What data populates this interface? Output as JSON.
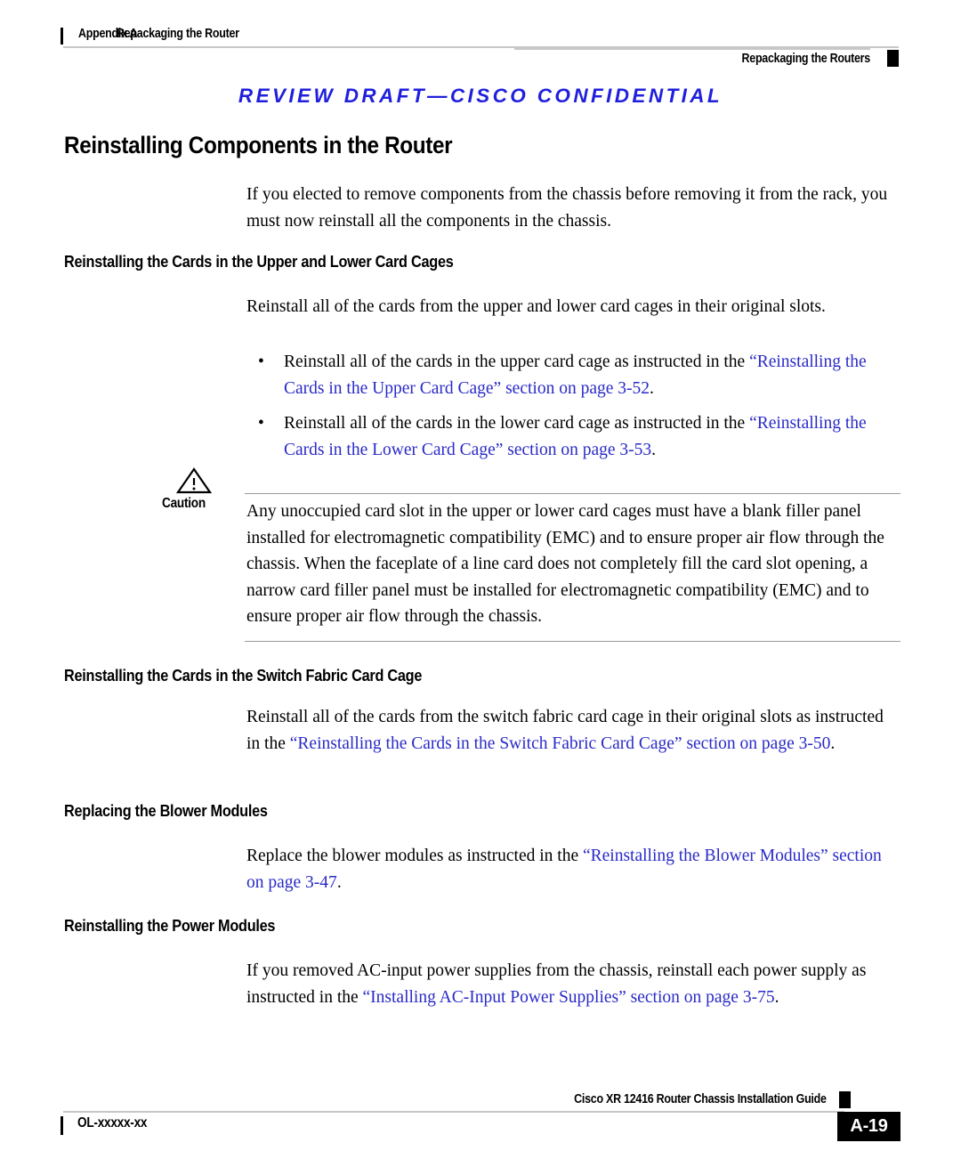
{
  "header": {
    "appendix_label": "Appendix A",
    "chapter_title": "Repackaging the Router",
    "book_running_title": "Repackaging the Routers"
  },
  "draft_banner": {
    "text": "REVIEW DRAFT—CISCO CONFIDENTIAL",
    "color": "#1f1fdd"
  },
  "section": {
    "title": "Reinstalling Components in the Router",
    "intro": "If you elected to remove components from the chassis before removing it from the rack, you must now reinstall all the components in the chassis."
  },
  "subsections": {
    "upper_lower": {
      "heading": "Reinstalling the Cards in the Upper and Lower Card Cages",
      "body": "Reinstall all of the cards from the upper and lower card cages in their original slots.",
      "bullets": [
        {
          "bullet": "•",
          "lead": "Reinstall all of the cards in the upper card cage as instructed in the ",
          "xref": "“Reinstalling the Cards in the Upper Card Cage” section on page 3-52",
          "tail": "."
        },
        {
          "bullet": "•",
          "lead": "Reinstall all of the cards in the lower card cage as instructed in the ",
          "xref": "“Reinstalling the Cards in the Lower Card Cage” section on page 3-53",
          "tail": "."
        }
      ]
    },
    "switch_fabric": {
      "heading": "Reinstalling the Cards in the Switch Fabric Card Cage",
      "lead": "Reinstall all of the cards from the switch fabric card cage in their original slots as instructed in the ",
      "xref": "“Reinstalling the Cards in the Switch Fabric Card Cage” section on page 3-50",
      "tail": "."
    },
    "blower": {
      "heading": "Replacing the Blower Modules",
      "lead": "Replace the blower modules as instructed in the ",
      "xref": "“Reinstalling the Blower Modules” section on page 3-47",
      "tail": "."
    },
    "power": {
      "heading": "Reinstalling the Power Modules",
      "lead": "If you removed AC-input power supplies from the chassis, reinstall each power supply as instructed in the ",
      "xref": "“Installing AC-Input Power Supplies” section on page 3-75",
      "tail": "."
    }
  },
  "caution": {
    "label": "Caution",
    "icon": "warning-triangle-icon",
    "text": "Any unoccupied card slot in the upper or lower card cages must have a blank filler panel installed for electromagnetic compatibility (EMC) and to ensure proper air flow through the chassis. When the faceplate of a line card does not completely fill the card slot opening, a narrow card filler panel must be installed for electromagnetic compatibility (EMC) and to ensure proper air flow through the chassis."
  },
  "footer": {
    "book_title": "Cisco XR 12416 Router Chassis Installation Guide",
    "doc_id": "OL-xxxxx-xx",
    "page_number": "A-19"
  },
  "colors": {
    "xref_blue": "#2a2ac8",
    "draft_blue": "#1f1fdd",
    "rule_gray": "#c7c7c7",
    "text_black": "#000000"
  }
}
